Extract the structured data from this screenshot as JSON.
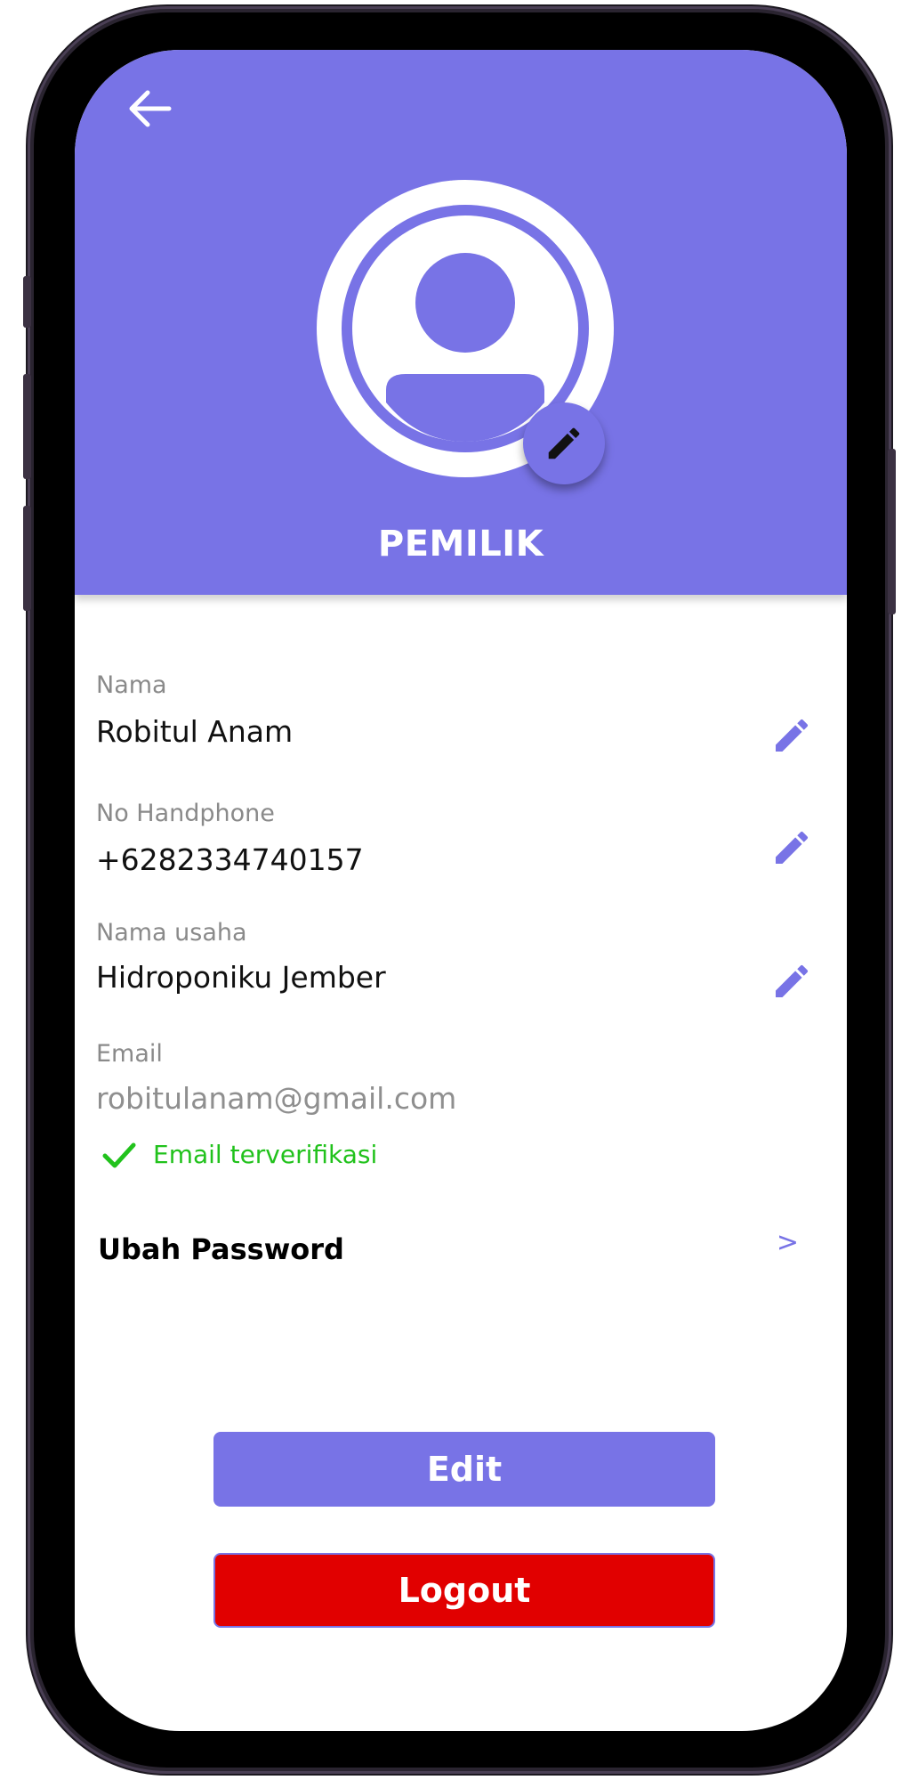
{
  "header": {
    "role_title": "PEMILIK",
    "background_color": "#7873e6"
  },
  "fields": [
    {
      "label": "Nama",
      "value": "Robitul Anam",
      "editable": true
    },
    {
      "label": "No Handphone",
      "value": "+6282334740157",
      "editable": true
    },
    {
      "label": "Nama usaha",
      "value": "Hidroponiku Jember",
      "editable": true
    },
    {
      "label": "Email",
      "value": "robitulanam@gmail.com",
      "editable": false
    }
  ],
  "email_status": {
    "text": "Email terverifikasi",
    "icon": "check-icon",
    "color": "#21c21c"
  },
  "change_password": {
    "label": "Ubah Password",
    "chevron": ">"
  },
  "actions": {
    "edit_label": "Edit",
    "logout_label": "Logout",
    "logout_color": "#e10000"
  },
  "icons": {
    "back": "arrow-left-icon",
    "avatar": "user-avatar-icon",
    "edit": "pencil-icon"
  }
}
